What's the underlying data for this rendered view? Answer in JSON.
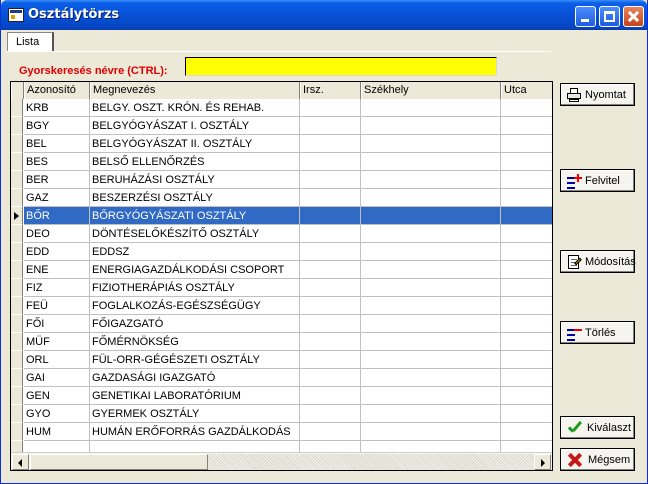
{
  "window": {
    "title": "Osztálytörzs"
  },
  "tabs": [
    {
      "label": "Lista"
    }
  ],
  "search": {
    "label": "Gyorskeresés névre (CTRL):",
    "value": ""
  },
  "grid": {
    "columns": [
      "Azonosító",
      "Megnevezés",
      "Irsz.",
      "Székhely",
      "Utca"
    ],
    "selected_row": 6,
    "rows": [
      [
        "KRB",
        "BELGY. OSZT. KRÓN. ÉS REHAB.",
        "",
        "",
        ""
      ],
      [
        "BGY",
        "BELGYÓGYÁSZAT I. OSZTÁLY",
        "",
        "",
        ""
      ],
      [
        "BEL",
        "BELGYÓGYÁSZAT II. OSZTÁLY",
        "",
        "",
        ""
      ],
      [
        "BES",
        "BELSŐ ELLENŐRZÉS",
        "",
        "",
        ""
      ],
      [
        "BER",
        "BERUHÁZÁSI OSZTÁLY",
        "",
        "",
        ""
      ],
      [
        "GAZ",
        "BESZERZÉSI OSZTÁLY",
        "",
        "",
        ""
      ],
      [
        "BŐR",
        "BŐRGYÓGYÁSZATI OSZTÁLY",
        "",
        "",
        ""
      ],
      [
        "DEO",
        "DÖNTÉSELŐKÉSZÍTŐ OSZTÁLY",
        "",
        "",
        ""
      ],
      [
        "EDD",
        "EDDSZ",
        "",
        "",
        ""
      ],
      [
        "ENE",
        "ENERGIAGAZDÁLKODÁSI CSOPORT",
        "",
        "",
        ""
      ],
      [
        "FIZ",
        "FIZIOTHERÁPIÁS OSZTÁLY",
        "",
        "",
        ""
      ],
      [
        "FEÜ",
        "FOGLALKOZÁS-EGÉSZSÉGÜGY",
        "",
        "",
        ""
      ],
      [
        "FŐI",
        "FŐIGAZGATÓ",
        "",
        "",
        ""
      ],
      [
        "MÜF",
        "FŐMÉRNÖKSÉG",
        "",
        "",
        ""
      ],
      [
        "ORL",
        "FÜL-ORR-GÉGÉSZETI OSZTÁLY",
        "",
        "",
        ""
      ],
      [
        "GAI",
        "GAZDASÁGI IGAZGATÓ",
        "",
        "",
        ""
      ],
      [
        "GEN",
        "GENETIKAI LABORATÓRIUM",
        "",
        "",
        ""
      ],
      [
        "GYO",
        "GYERMEK OSZTÁLY",
        "",
        "",
        ""
      ],
      [
        "HUM",
        "HUMÁN ERŐFORRÁS GAZDÁLKODÁS",
        "",
        "",
        ""
      ],
      [
        "",
        "",
        "",
        "",
        ""
      ]
    ]
  },
  "buttons": {
    "print": "Nyomtat",
    "add": "Felvitel",
    "edit": "Módosítás",
    "delete": "Törlés",
    "select": "Kiválaszt",
    "cancel": "Mégsem"
  },
  "colors": {
    "selection": "#316ac5",
    "search_bg": "#ffff00",
    "label_red": "#e00000"
  }
}
